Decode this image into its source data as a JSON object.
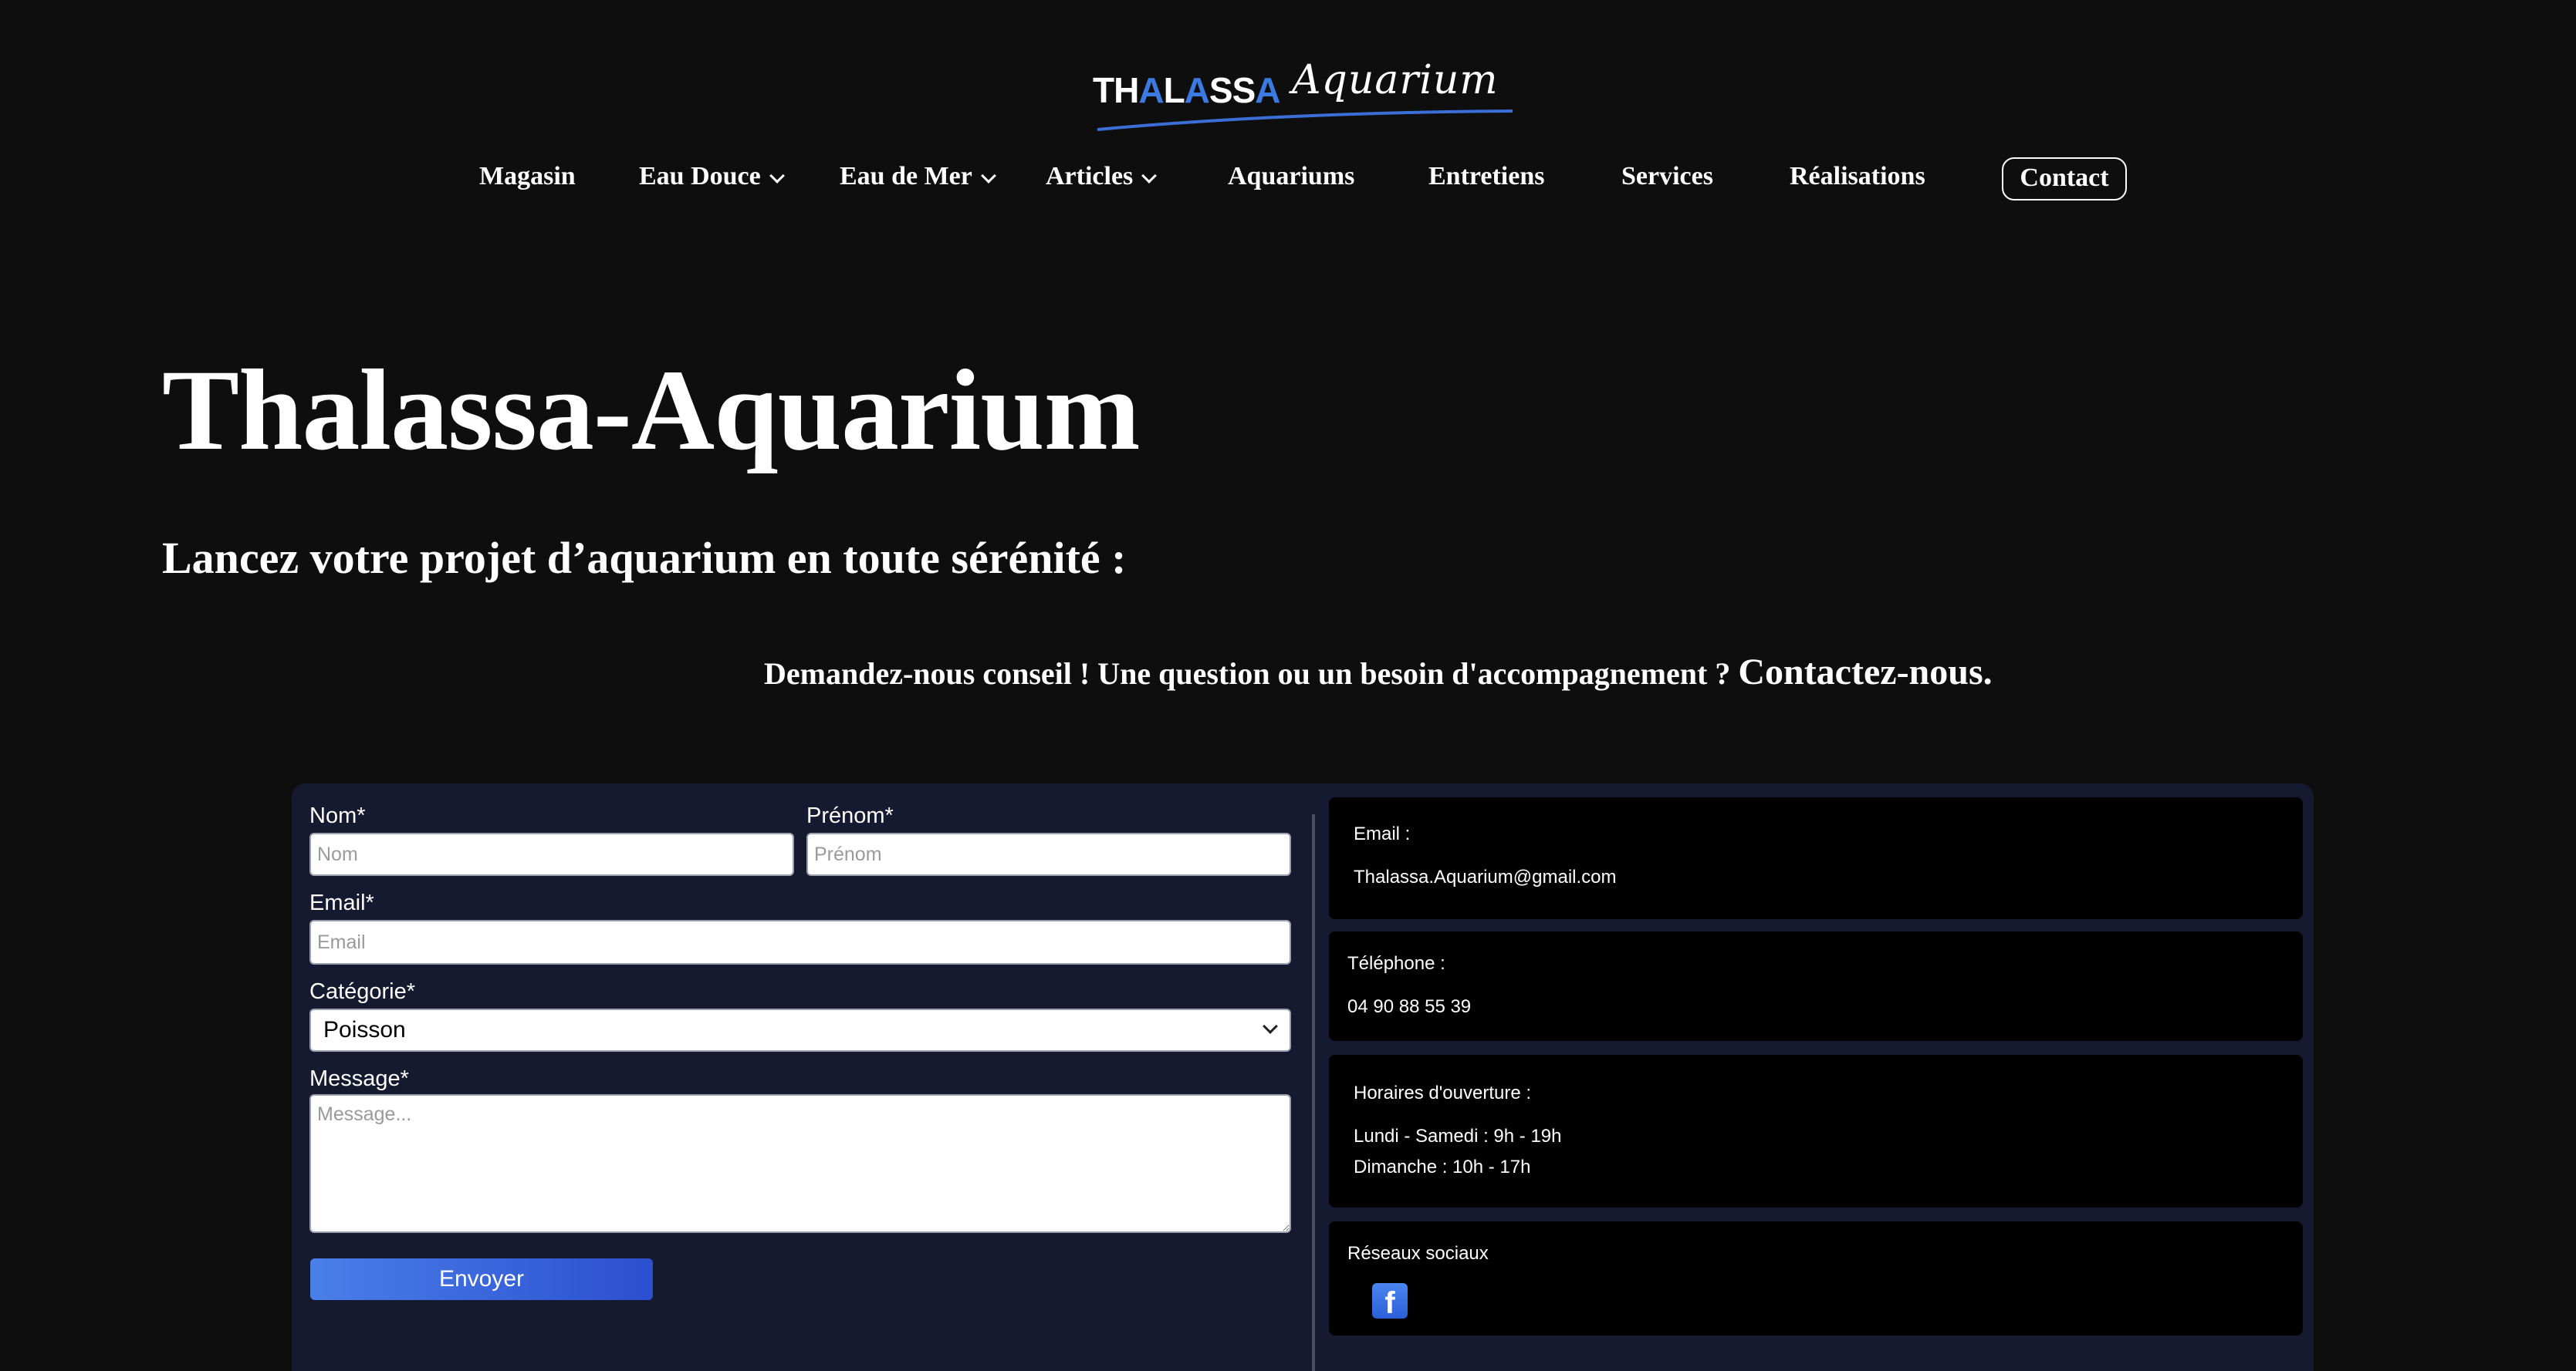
{
  "logo": {
    "word": "THALASSA",
    "script": "Aquarium"
  },
  "nav": {
    "items": [
      {
        "label": "Magasin"
      },
      {
        "label": "Eau Douce"
      },
      {
        "label": "Eau de Mer"
      },
      {
        "label": "Articles"
      },
      {
        "label": "Aquariums"
      },
      {
        "label": "Entretiens"
      },
      {
        "label": "Services"
      },
      {
        "label": "Réalisations"
      }
    ],
    "contact": "Contact"
  },
  "hero": {
    "title": "Thalassa-Aquarium",
    "subtitle": "Lancez votre projet d’aquarium en toute sérénité :",
    "cta_text": "Demandez-nous conseil ! Une question ou un besoin d'accompagnement ? ",
    "cta_link": "Contactez-nous."
  },
  "form": {
    "nom_label": "Nom*",
    "nom_placeholder": "Nom",
    "prenom_label": "Prénom*",
    "prenom_placeholder": "Prénom",
    "email_label": "Email*",
    "email_placeholder": "Email",
    "categorie_label": "Catégorie*",
    "categorie_value": "Poisson",
    "message_label": "Message*",
    "message_placeholder": "Message...",
    "submit": "Envoyer"
  },
  "info": {
    "email_title": "Email :",
    "email_value": "Thalassa.Aquarium@gmail.com",
    "phone_title": "Téléphone :",
    "phone_value": "04 90 88 55 39",
    "hours_title": "Horaires d'ouverture :",
    "hours_line1": "Lundi - Samedi : 9h - 19h",
    "hours_line2": "Dimanche : 10h - 17h",
    "social_title": "Réseaux sociaux",
    "social_icon": "facebook-icon"
  },
  "colors": {
    "background": "#0e0e0e",
    "panel": "#151a30",
    "button": "#3a66dd",
    "logo_accent": "#3b7ae0"
  }
}
